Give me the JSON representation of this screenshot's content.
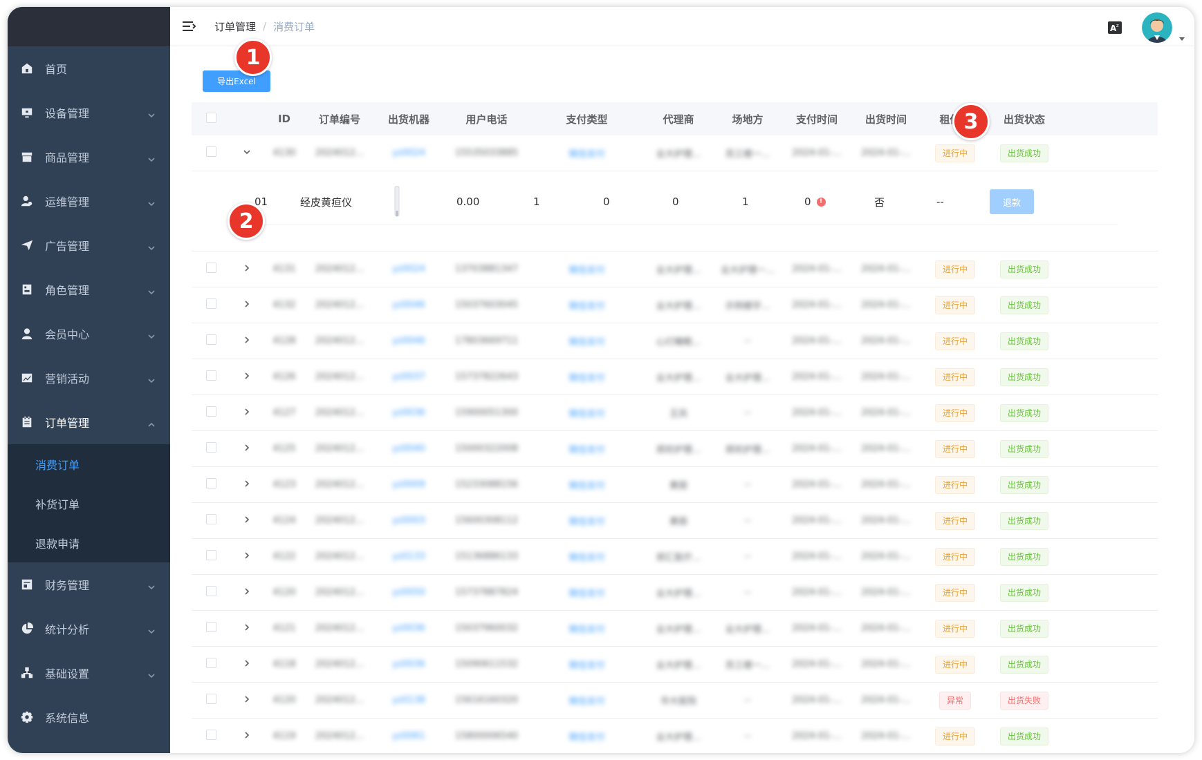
{
  "sidebar": {
    "items": [
      {
        "label": "首页",
        "icon": "home-icon"
      },
      {
        "label": "设备管理",
        "icon": "monitor-icon"
      },
      {
        "label": "商品管理",
        "icon": "shop-icon"
      },
      {
        "label": "运维管理",
        "icon": "user-gear-icon"
      },
      {
        "label": "广告管理",
        "icon": "send-icon"
      },
      {
        "label": "角色管理",
        "icon": "role-icon"
      },
      {
        "label": "会员中心",
        "icon": "user-icon"
      },
      {
        "label": "营销活动",
        "icon": "chart-icon"
      },
      {
        "label": "订单管理",
        "icon": "order-icon"
      }
    ],
    "sub_items": [
      {
        "label": "消费订单"
      },
      {
        "label": "补货订单"
      },
      {
        "label": "退款申请"
      }
    ],
    "bottom_items": [
      {
        "label": "财务管理",
        "icon": "finance-icon"
      },
      {
        "label": "统计分析",
        "icon": "pie-icon"
      },
      {
        "label": "基础设置",
        "icon": "network-icon"
      },
      {
        "label": "系统信息",
        "icon": "gear-icon"
      }
    ]
  },
  "breadcrumb": {
    "parent": "订单管理",
    "sep": "/",
    "current": "消费订单"
  },
  "toolbar": {
    "export_label": "导出Excel"
  },
  "markers": [
    "1",
    "2",
    "3"
  ],
  "table": {
    "headers": [
      "ID",
      "订单编号",
      "出货机器",
      "用户电话",
      "支付类型",
      "代理商",
      "场地方",
      "支付时间",
      "出货时间",
      "租借状",
      "出货状态"
    ],
    "first_row": {
      "id": "4130",
      "order_no": "2024012...",
      "machine": "yz0024",
      "phone": "15535033885",
      "pay_type": "微信支付",
      "agent": "业大护理...",
      "venue": "员工楼一...",
      "pay_time": "2024-01-...",
      "ship_time": "2024-01-...",
      "rent_status": "进行中",
      "ship_status": "出货成功"
    },
    "detail": {
      "slot": "01",
      "product": "经皮黄疸仪",
      "price": "0.00",
      "c1": "1",
      "c2": "0",
      "c3": "0",
      "c4": "1",
      "c5": "0",
      "dot": "!",
      "flag": "否",
      "dash": "--",
      "refund_label": "退款"
    },
    "rows": [
      {
        "id": "4131",
        "order_no": "2024012...",
        "machine": "yz0024",
        "phone": "13703881347",
        "pay_type": "微信支付",
        "agent": "业大护理...",
        "venue": "业大护理一...",
        "pay_time": "2024-01-...",
        "ship_time": "2024-01-...",
        "rent_status": "进行中",
        "ship_status": "出货成功",
        "rent_type": "warn",
        "ship_type": "ok"
      },
      {
        "id": "4132",
        "order_no": "2024012...",
        "machine": "yz0046",
        "phone": "15037603045",
        "pay_type": "微信支付",
        "agent": "业大护理...",
        "venue": "示例楼宇...",
        "pay_time": "2024-01-...",
        "ship_time": "2024-01-...",
        "rent_status": "进行中",
        "ship_status": "出货成功",
        "rent_type": "warn",
        "ship_type": "ok"
      },
      {
        "id": "4128",
        "order_no": "2024012...",
        "machine": "yz0046",
        "phone": "17803669711",
        "pay_type": "微信支付",
        "agent": "心灯睡眠...",
        "venue": "--",
        "pay_time": "2024-01-...",
        "ship_time": "2024-01-...",
        "rent_status": "进行中",
        "ship_status": "出货成功",
        "rent_type": "warn",
        "ship_type": "ok"
      },
      {
        "id": "4126",
        "order_no": "2024012...",
        "machine": "yz0037",
        "phone": "15737822643",
        "pay_type": "微信支付",
        "agent": "业大护理...",
        "venue": "业大护理...",
        "pay_time": "2024-01-...",
        "ship_time": "2024-01-...",
        "rent_status": "进行中",
        "ship_status": "出货成功",
        "rent_type": "warn",
        "ship_type": "ok"
      },
      {
        "id": "4127",
        "order_no": "2024012...",
        "machine": "yz0036",
        "phone": "15900051300",
        "pay_type": "微信支付",
        "agent": "王凤",
        "venue": "--",
        "pay_time": "2024-01-...",
        "ship_time": "2024-01-...",
        "rent_status": "进行中",
        "ship_status": "出货成功",
        "rent_type": "warn",
        "ship_type": "ok"
      },
      {
        "id": "4125",
        "order_no": "2024012...",
        "machine": "yz0040",
        "phone": "15000322008",
        "pay_type": "微信支付",
        "agent": "郑欢护理...",
        "venue": "郑欢护理...",
        "pay_time": "2024-01-...",
        "ship_time": "2024-01-...",
        "rent_status": "进行中",
        "ship_status": "出货成功",
        "rent_type": "warn",
        "ship_type": "ok"
      },
      {
        "id": "4123",
        "order_no": "2024012...",
        "machine": "yz0009",
        "phone": "15233088156",
        "pay_type": "微信支付",
        "agent": "黄丽",
        "venue": "--",
        "pay_time": "2024-01-...",
        "ship_time": "2024-01-...",
        "rent_status": "进行中",
        "ship_status": "出货成功",
        "rent_type": "warn",
        "ship_type": "ok"
      },
      {
        "id": "4124",
        "order_no": "2024012...",
        "machine": "yz0003",
        "phone": "15600308112",
        "pay_type": "微信支付",
        "agent": "黄丽",
        "venue": "--",
        "pay_time": "2024-01-...",
        "ship_time": "2024-01-...",
        "rent_status": "进行中",
        "ship_status": "出货成功",
        "rent_type": "warn",
        "ship_type": "ok"
      },
      {
        "id": "4122",
        "order_no": "2024012...",
        "machine": "yz0133",
        "phone": "15136886133",
        "pay_type": "微信支付",
        "agent": "郑汇医疗...",
        "venue": "--",
        "pay_time": "2024-01-...",
        "ship_time": "2024-01-...",
        "rent_status": "进行中",
        "ship_status": "出货成功",
        "rent_type": "warn",
        "ship_type": "ok"
      },
      {
        "id": "4120",
        "order_no": "2024012...",
        "machine": "yz0050",
        "phone": "15737887824",
        "pay_type": "微信支付",
        "agent": "业大护理...",
        "venue": "--",
        "pay_time": "2024-01-...",
        "ship_time": "2024-01-...",
        "rent_status": "进行中",
        "ship_status": "出货成功",
        "rent_type": "warn",
        "ship_type": "ok"
      },
      {
        "id": "4121",
        "order_no": "2024012...",
        "machine": "yz0036",
        "phone": "15037960032",
        "pay_type": "微信支付",
        "agent": "业大护理...",
        "venue": "业大护理...",
        "pay_time": "2024-01-...",
        "ship_time": "2024-01-...",
        "rent_status": "进行中",
        "ship_status": "出货成功",
        "rent_type": "warn",
        "ship_type": "ok"
      },
      {
        "id": "4118",
        "order_no": "2024012...",
        "machine": "yz0036",
        "phone": "15090611532",
        "pay_type": "微信支付",
        "agent": "业大护理...",
        "venue": "员工楼一...",
        "pay_time": "2024-01-...",
        "ship_time": "2024-01-...",
        "rent_status": "进行中",
        "ship_status": "出货成功",
        "rent_type": "warn",
        "ship_type": "ok"
      },
      {
        "id": "4120",
        "order_no": "2024012...",
        "machine": "yz0138",
        "phone": "15616160320",
        "pay_type": "微信支付",
        "agent": "华大医院",
        "venue": "--",
        "pay_time": "2024-01-...",
        "ship_time": "2024-01-...",
        "rent_status": "异常",
        "ship_status": "出货失败",
        "rent_type": "err",
        "ship_type": "err"
      },
      {
        "id": "4119",
        "order_no": "2024012...",
        "machine": "yz0061",
        "phone": "15800006540",
        "pay_type": "微信支付",
        "agent": "业大护理...",
        "venue": "--",
        "pay_time": "2024-01-...",
        "ship_time": "2024-01-...",
        "rent_status": "进行中",
        "ship_status": "出货成功",
        "rent_type": "warn",
        "ship_type": "ok"
      }
    ]
  },
  "colors": {
    "sidebar_bg": "#304156",
    "submenu_bg": "#1f2d3d",
    "primary": "#409eff",
    "marker": "#e8362b"
  }
}
